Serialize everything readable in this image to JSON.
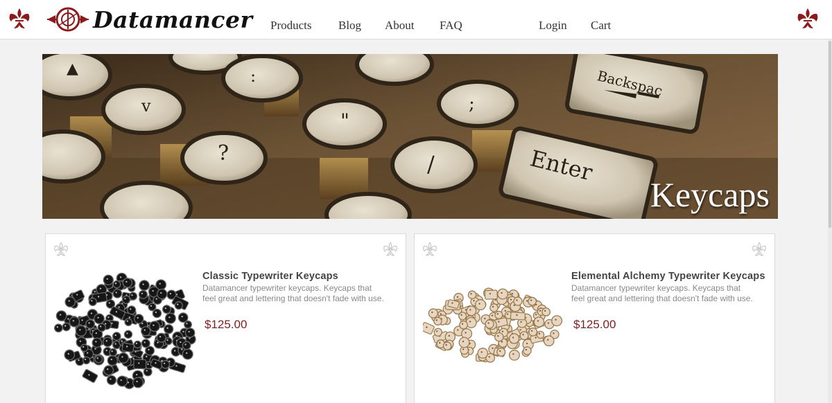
{
  "brand": {
    "name": "Datamancer",
    "accent_color": "#8b1a1a",
    "logo_icon": "alchemy-seal-icon",
    "header_icon": "fleur-de-lis-icon"
  },
  "nav": {
    "products": "Products",
    "blog": "Blog",
    "about": "About",
    "faq": "FAQ",
    "login": "Login",
    "cart": "Cart"
  },
  "hero": {
    "title": "Keycaps",
    "image": "vintage-typewriter-keys-photo",
    "key_labels": [
      "Backspace",
      "Enter"
    ]
  },
  "products": [
    {
      "title": "Classic Typewriter Keycaps",
      "description": "Datamancer typewriter keycaps. Keycaps that feel great and lettering that doesn't fade with use.",
      "price": "$125.00",
      "image": "black-round-keycaps-pile"
    },
    {
      "title": "Elemental Alchemy Typewriter Keycaps",
      "description": "Datamancer typewriter keycaps. Keycaps that feel great and lettering that doesn't fade with use.",
      "price": "$125.00",
      "image": "brass-round-keycaps-pile"
    }
  ]
}
